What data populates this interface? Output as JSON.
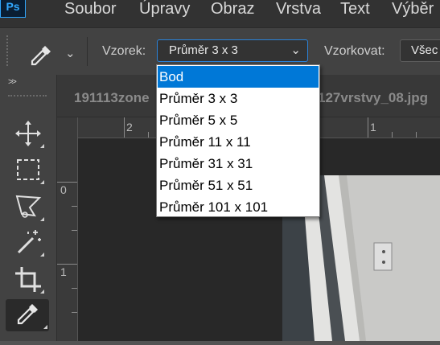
{
  "app": {
    "logo_text": "Ps"
  },
  "menu": [
    "Soubor",
    "Úpravy",
    "Obraz",
    "Vrstva",
    "Text",
    "Výběr"
  ],
  "options_bar": {
    "tool_icon": "eyedropper-icon",
    "vzorek_label": "Vzorek:",
    "vzorek_value": "Průměr 3 x 3",
    "vzorkovat_label": "Vzorkovat:",
    "vzorkovat_value": "Všec"
  },
  "dropdown": {
    "options": [
      "Bod",
      "Průměr 3 x 3",
      "Průměr 5 x 5",
      "Průměr 11 x 11",
      "Průměr 31 x 31",
      "Průměr 51 x 51",
      "Průměr 101 x 101"
    ],
    "highlighted": "Bod"
  },
  "toolbar": {
    "collapse": ">>",
    "tools": [
      "move-tool",
      "marquee-tool",
      "lasso-tool",
      "magic-wand-tool",
      "crop-tool",
      "eyedropper-tool"
    ]
  },
  "tabs": [
    "191113zone",
    "127vrstvy_08.jpg"
  ],
  "rulers": {
    "h_labels": [
      "2",
      "1"
    ],
    "v_labels": [
      "0",
      "1"
    ]
  },
  "colors": {
    "accent": "#31a8ff",
    "selection": "#0078d7"
  }
}
